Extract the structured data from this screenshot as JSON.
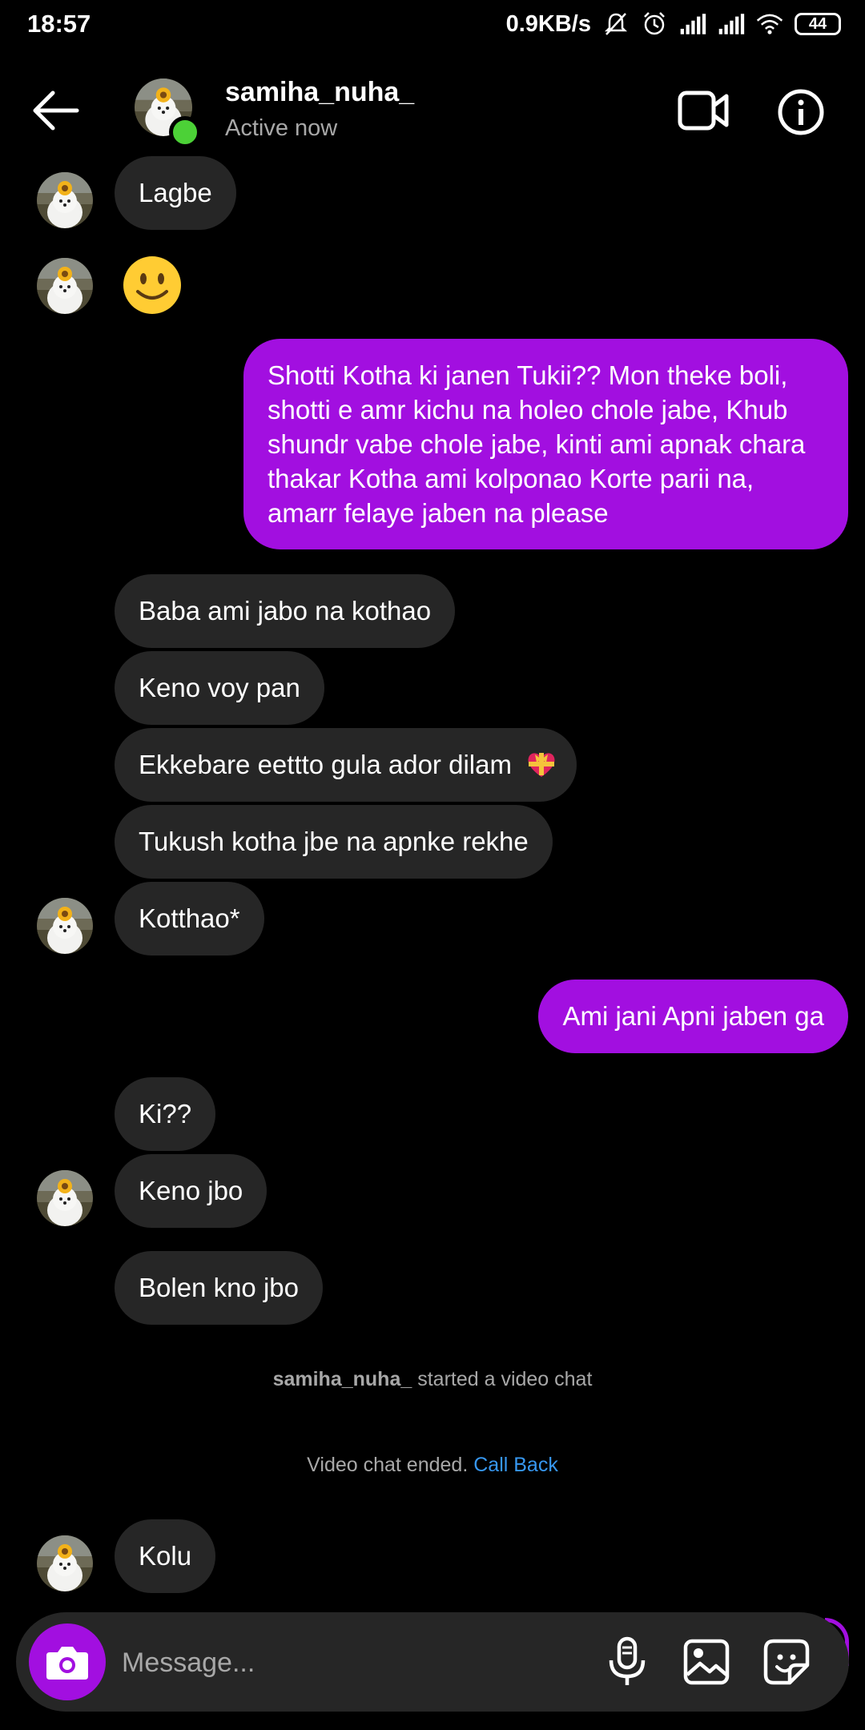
{
  "status_bar": {
    "time": "18:57",
    "net_speed": "0.9KB/s",
    "battery": "44",
    "icons": [
      "mute-icon",
      "alarm-icon",
      "signal-icon",
      "signal-icon",
      "wifi-icon",
      "battery-icon"
    ]
  },
  "header": {
    "username": "samiha_nuha_",
    "status": "Active now",
    "online_color": "#4cd137",
    "icons": [
      "back-arrow-icon",
      "video-camera-icon",
      "info-icon"
    ]
  },
  "messages": [
    {
      "from": "them",
      "text": "Lagbe"
    },
    {
      "from": "them",
      "emoji": "slightly-smiling-face"
    },
    {
      "from": "me",
      "text": "Shotti Kotha ki janen Tukii?? Mon theke boli, shotti e amr kichu na holeo chole jabe, Khub shundr vabe chole jabe, kinti ami apnak chara thakar Kotha ami kolponao Korte parii na, amarr felaye jaben na please"
    },
    {
      "from": "them",
      "text": "Baba ami jabo na kothao"
    },
    {
      "from": "them",
      "text": "Keno voy pan"
    },
    {
      "from": "them",
      "text": "Ekkebare eettto gula ador dilam",
      "emoji": "heart-with-ribbon"
    },
    {
      "from": "them",
      "text": "Tukush kotha jbe na apnke rekhe"
    },
    {
      "from": "them",
      "text": "Kotthao*"
    },
    {
      "from": "me",
      "text": "Ami jani Apni jaben ga"
    },
    {
      "from": "them",
      "text": "Ki??"
    },
    {
      "from": "them",
      "text": "Keno jbo"
    },
    {
      "from": "them",
      "text": "Bolen kno jbo"
    },
    {
      "from": "them",
      "text": "Kolu"
    }
  ],
  "system_messages": {
    "video_started_user": "samiha_nuha_",
    "video_started_text": "started a video chat",
    "video_ended_text": "Video chat ended.",
    "call_back": "Call Back"
  },
  "composer": {
    "placeholder": "Message...",
    "icons": [
      "camera-icon",
      "microphone-icon",
      "gallery-icon",
      "sticker-icon"
    ]
  },
  "colors": {
    "background": "#000000",
    "incoming_bubble": "#262626",
    "outgoing_bubble": "#a20fe0",
    "link": "#3797f0",
    "secondary_text": "#a8a8a8"
  }
}
